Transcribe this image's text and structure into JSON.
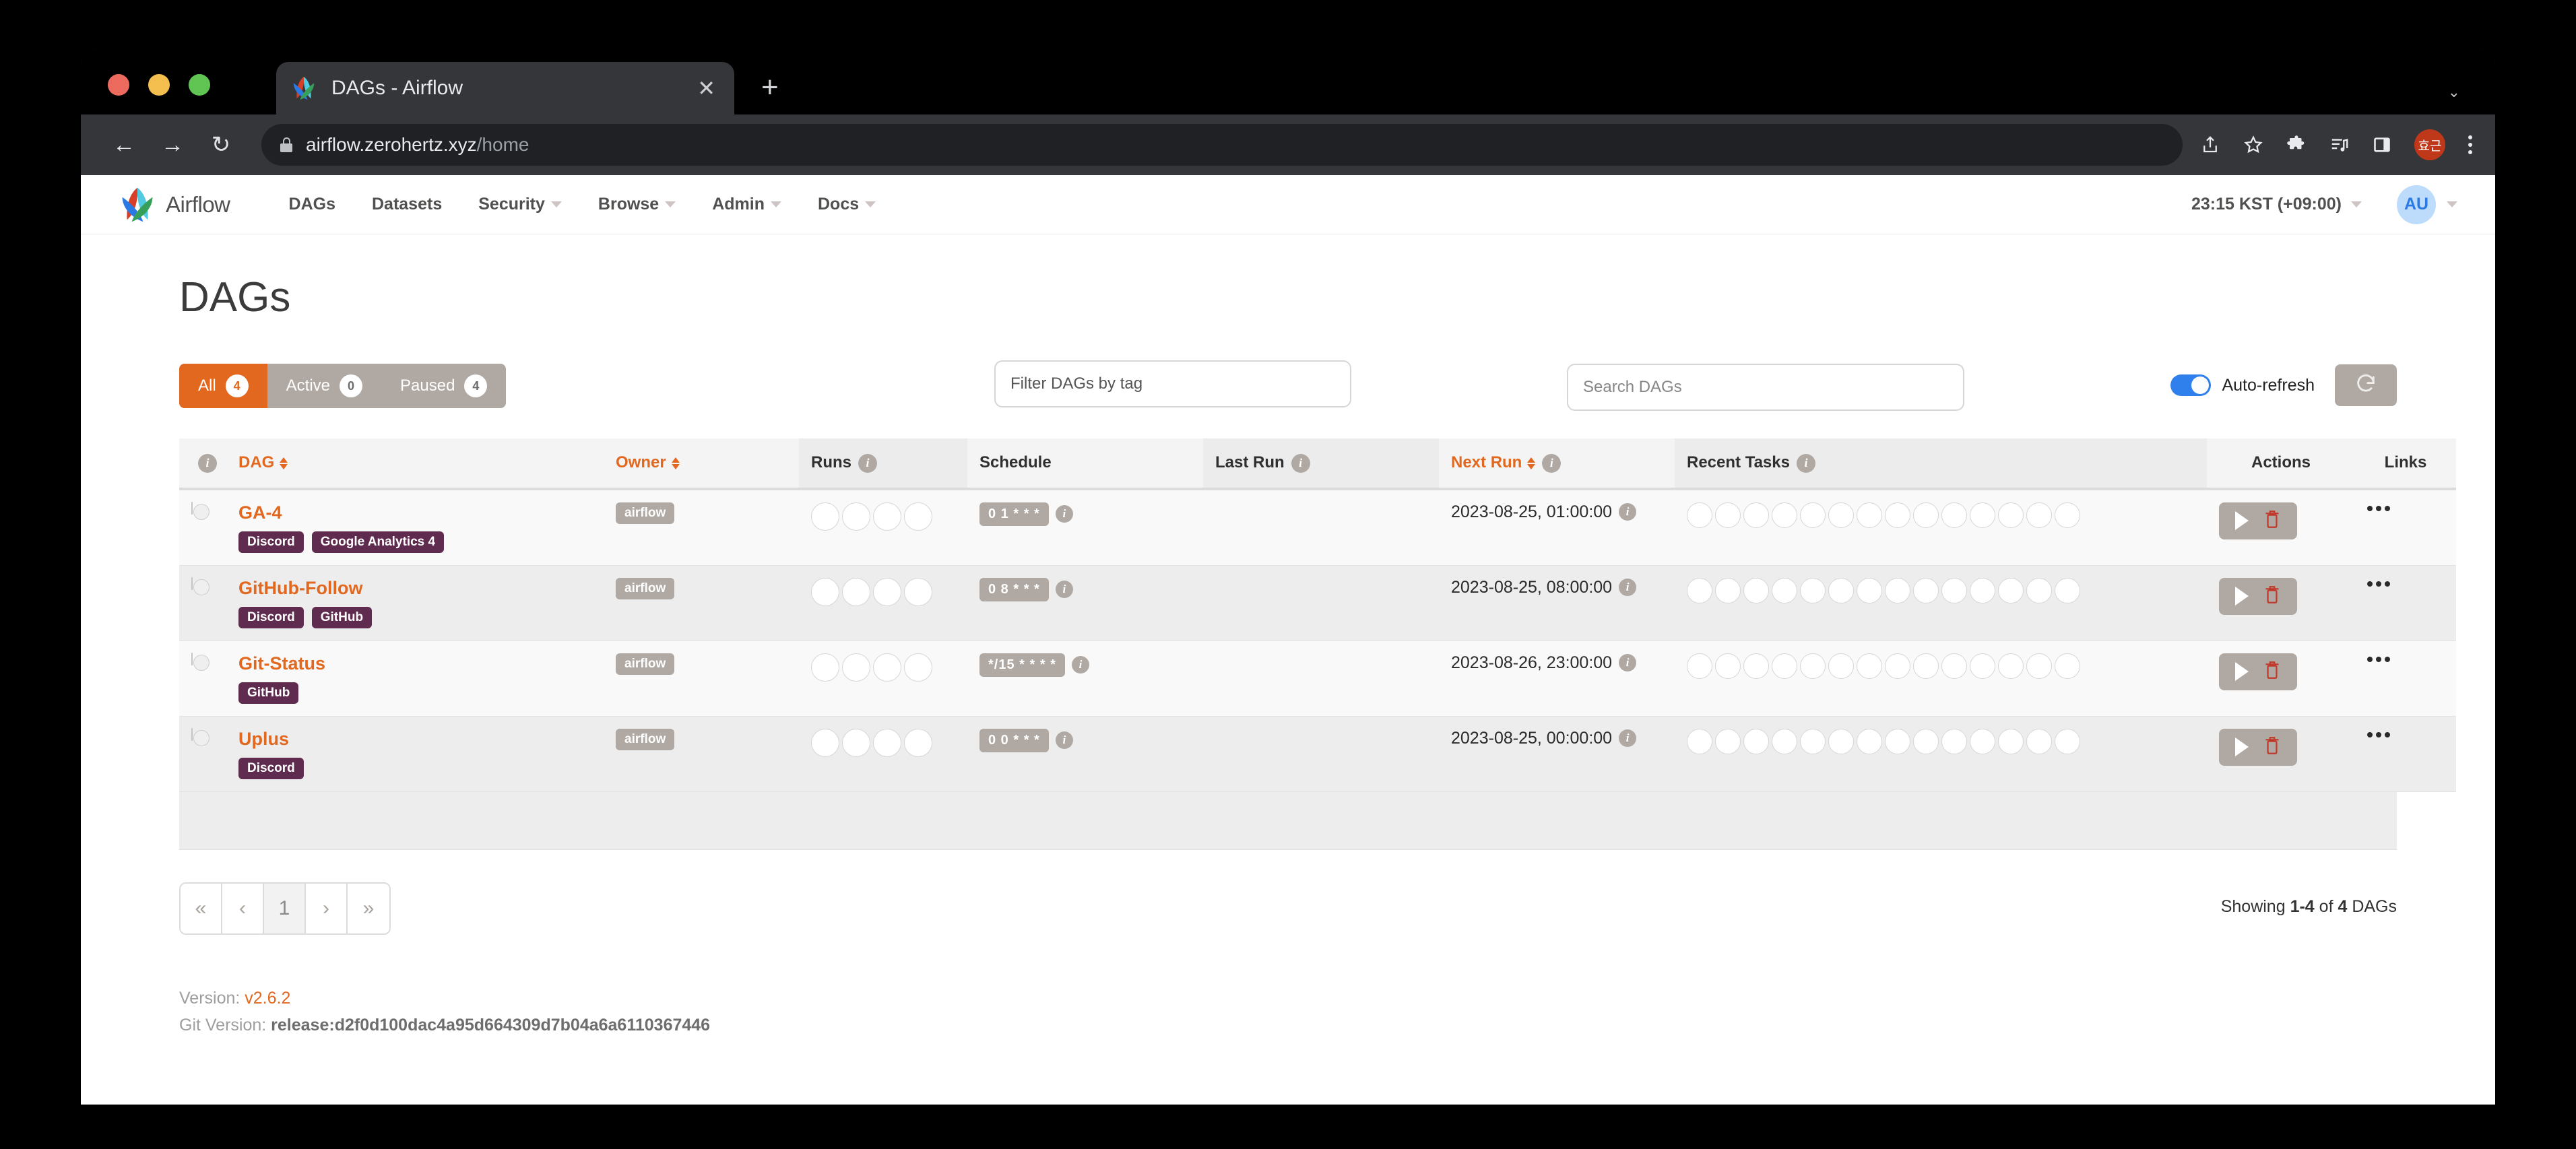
{
  "browser": {
    "tab_title": "DAGs - Airflow",
    "tab_close": "✕",
    "new_tab": "+",
    "tab_list_chevron": "⌄",
    "back": "←",
    "forward": "→",
    "reload": "↻",
    "url_host": "airflow.zerohertz.xyz",
    "url_path": "/home",
    "profile_initials": "효근"
  },
  "nav": {
    "brand": "Airflow",
    "items": [
      {
        "label": "DAGs",
        "has_caret": false
      },
      {
        "label": "Datasets",
        "has_caret": false
      },
      {
        "label": "Security",
        "has_caret": true
      },
      {
        "label": "Browse",
        "has_caret": true
      },
      {
        "label": "Admin",
        "has_caret": true
      },
      {
        "label": "Docs",
        "has_caret": true
      }
    ],
    "clock": "23:15 KST (+09:00)",
    "avatar": "AU"
  },
  "page": {
    "title": "DAGs"
  },
  "controls": {
    "tabs": [
      {
        "label": "All",
        "count": "4",
        "active": true
      },
      {
        "label": "Active",
        "count": "0",
        "active": false
      },
      {
        "label": "Paused",
        "count": "4",
        "active": false
      }
    ],
    "tag_filter_placeholder": "Filter DAGs by tag",
    "search_placeholder": "Search DAGs",
    "autorefresh_label": "Auto-refresh",
    "autorefresh_on": true,
    "refresh_icon": "refresh-icon"
  },
  "table": {
    "columns": [
      {
        "key": "toggle",
        "label": "",
        "info": true,
        "sortable": false
      },
      {
        "key": "dag",
        "label": "DAG",
        "info": false,
        "sortable": true
      },
      {
        "key": "owner",
        "label": "Owner",
        "info": false,
        "sortable": true
      },
      {
        "key": "runs",
        "label": "Runs",
        "info": true,
        "sortable": false
      },
      {
        "key": "schedule",
        "label": "Schedule",
        "info": false,
        "sortable": false
      },
      {
        "key": "last_run",
        "label": "Last Run",
        "info": true,
        "sortable": false
      },
      {
        "key": "next_run",
        "label": "Next Run",
        "info": true,
        "sortable": true
      },
      {
        "key": "recent_tasks",
        "label": "Recent Tasks",
        "info": true,
        "sortable": false
      },
      {
        "key": "actions",
        "label": "Actions",
        "info": false,
        "sortable": false
      },
      {
        "key": "links",
        "label": "Links",
        "info": false,
        "sortable": false
      }
    ],
    "runs_circle_count": 4,
    "tasks_circle_count": 14,
    "rows": [
      {
        "name": "GA-4",
        "paused": true,
        "tags": [
          "Discord",
          "Google Analytics 4"
        ],
        "owner": "airflow",
        "schedule": "0 1 * * *",
        "last_run": "",
        "next_run": "2023-08-25, 01:00:00",
        "links": "…"
      },
      {
        "name": "GitHub-Follow",
        "paused": true,
        "tags": [
          "Discord",
          "GitHub"
        ],
        "owner": "airflow",
        "schedule": "0 8 * * *",
        "last_run": "",
        "next_run": "2023-08-25, 08:00:00",
        "links": "…"
      },
      {
        "name": "Git-Status",
        "paused": true,
        "tags": [
          "GitHub"
        ],
        "owner": "airflow",
        "schedule": "*/15 * * * *",
        "last_run": "",
        "next_run": "2023-08-26, 23:00:00",
        "links": "…"
      },
      {
        "name": "Uplus",
        "paused": true,
        "tags": [
          "Discord"
        ],
        "owner": "airflow",
        "schedule": "0 0 * * *",
        "last_run": "",
        "next_run": "2023-08-25, 00:00:00",
        "links": "…"
      }
    ]
  },
  "pagination": {
    "first": "«",
    "prev": "‹",
    "current": "1",
    "next": "›",
    "last": "»",
    "showing_prefix": "Showing ",
    "showing_range": "1-4",
    "showing_mid": " of ",
    "showing_total": "4",
    "showing_suffix": " DAGs"
  },
  "footer": {
    "version_label": "Version: ",
    "version_value": "v2.6.2",
    "git_label": "Git Version: ",
    "git_value": "release:d2f0d100dac4a95d664309d7b04a6a6110367446"
  },
  "colors": {
    "accent": "#e2681f",
    "tag": "#5f2b4e",
    "muted": "#b0a9a3",
    "toggle_on": "#2f80ed"
  }
}
